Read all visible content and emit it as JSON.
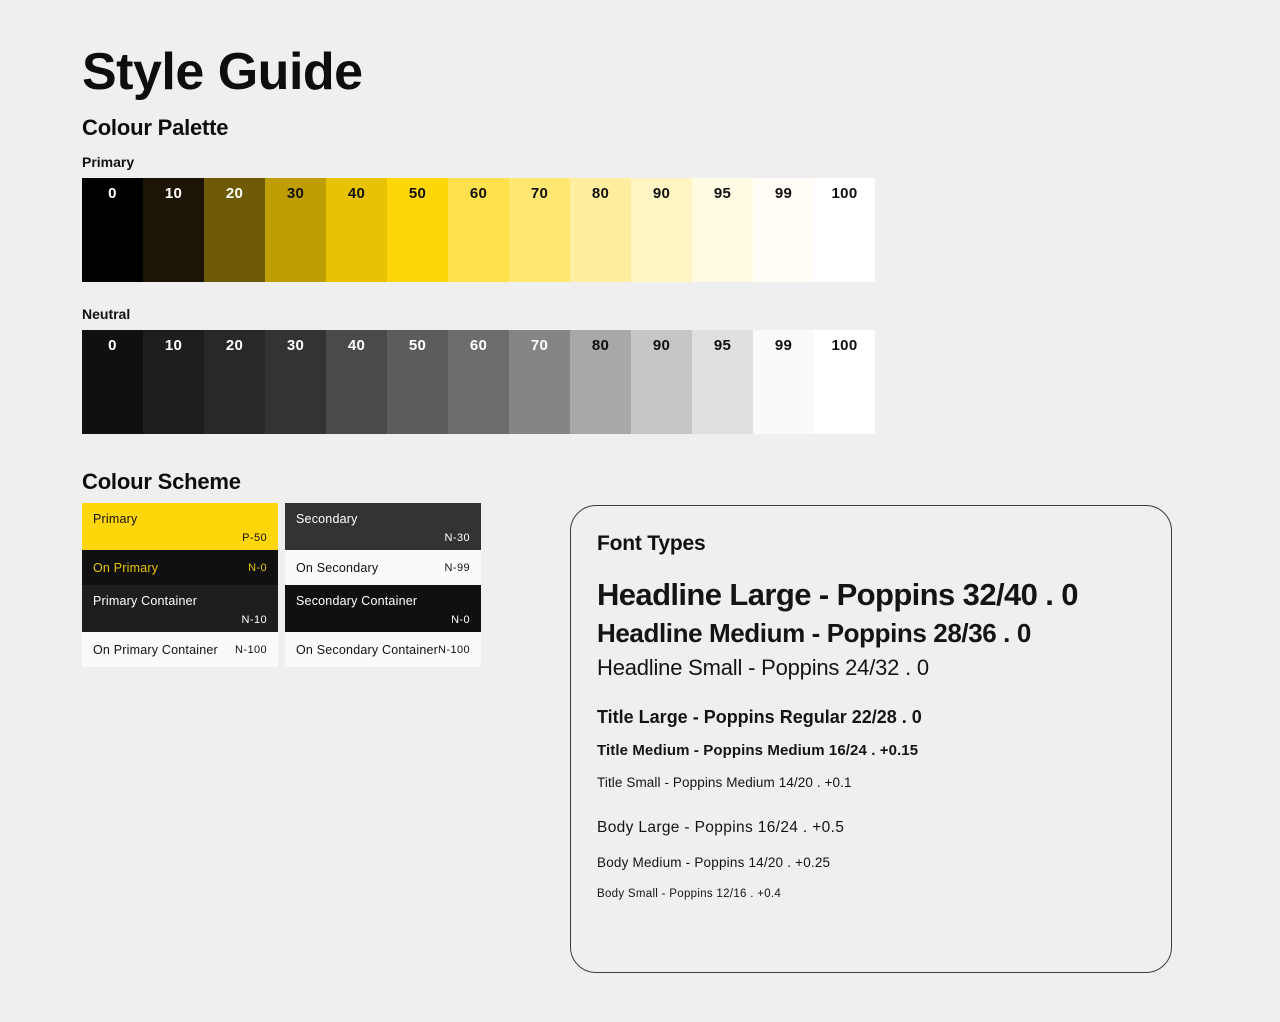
{
  "page": {
    "title": "Style Guide",
    "background": "#efefef"
  },
  "palette_section": {
    "title": "Colour Palette",
    "primary": {
      "label": "Primary",
      "tones": [
        {
          "label": "0",
          "hex": "#000000",
          "text": "#ffffff"
        },
        {
          "label": "10",
          "hex": "#1c1503",
          "text": "#ffffff"
        },
        {
          "label": "20",
          "hex": "#6e5a04",
          "text": "#ffffff"
        },
        {
          "label": "30",
          "hex": "#bf9e05",
          "text": "#111111"
        },
        {
          "label": "40",
          "hex": "#e8c303",
          "text": "#111111"
        },
        {
          "label": "50",
          "hex": "#ffd60a",
          "text": "#111111"
        },
        {
          "label": "60",
          "hex": "#ffe04d",
          "text": "#111111"
        },
        {
          "label": "70",
          "hex": "#ffe772",
          "text": "#111111"
        },
        {
          "label": "80",
          "hex": "#ffeea0",
          "text": "#111111"
        },
        {
          "label": "90",
          "hex": "#fff4c4",
          "text": "#111111"
        },
        {
          "label": "95",
          "hex": "#fffae2",
          "text": "#111111"
        },
        {
          "label": "99",
          "hex": "#fffdf5",
          "text": "#111111"
        },
        {
          "label": "100",
          "hex": "#ffffff",
          "text": "#111111"
        }
      ]
    },
    "neutral": {
      "label": "Neutral",
      "tones": [
        {
          "label": "0",
          "hex": "#101010",
          "text": "#ffffff"
        },
        {
          "label": "10",
          "hex": "#1e1e1e",
          "text": "#ffffff"
        },
        {
          "label": "20",
          "hex": "#282828",
          "text": "#ffffff"
        },
        {
          "label": "30",
          "hex": "#333333",
          "text": "#ffffff"
        },
        {
          "label": "40",
          "hex": "#4a4a4a",
          "text": "#ffffff"
        },
        {
          "label": "50",
          "hex": "#5c5c5c",
          "text": "#ffffff"
        },
        {
          "label": "60",
          "hex": "#6c6c6c",
          "text": "#ffffff"
        },
        {
          "label": "70",
          "hex": "#858585",
          "text": "#ffffff"
        },
        {
          "label": "80",
          "hex": "#a8a8a8",
          "text": "#111111"
        },
        {
          "label": "90",
          "hex": "#c6c6c6",
          "text": "#111111"
        },
        {
          "label": "95",
          "hex": "#e0e0e0",
          "text": "#111111"
        },
        {
          "label": "99",
          "hex": "#fafafa",
          "text": "#111111"
        },
        {
          "label": "100",
          "hex": "#ffffff",
          "text": "#111111"
        }
      ]
    }
  },
  "scheme_section": {
    "title": "Colour Scheme",
    "primary_card": [
      {
        "name": "Primary",
        "token": "P-50",
        "bg": "#ffd60a",
        "fg": "#111111",
        "layout": "tall"
      },
      {
        "name": "On Primary",
        "token": "N-0",
        "bg": "#101010",
        "fg": "#e8c30a",
        "layout": "compact"
      },
      {
        "name": "Primary Container",
        "token": "N-10",
        "bg": "#1e1e1e",
        "fg": "#ffffff",
        "layout": "tall"
      },
      {
        "name": "On Primary Container",
        "token": "N-100",
        "bg": "#fafafa",
        "fg": "#111111",
        "layout": "compact"
      }
    ],
    "secondary_card": [
      {
        "name": "Secondary",
        "token": "N-30",
        "bg": "#333333",
        "fg": "#ffffff",
        "layout": "tall"
      },
      {
        "name": "On Secondary",
        "token": "N-99",
        "bg": "#fafafa",
        "fg": "#111111",
        "layout": "compact"
      },
      {
        "name": "Secondary Container",
        "token": "N-0",
        "bg": "#101010",
        "fg": "#ffffff",
        "layout": "tall"
      },
      {
        "name": "On Secondary Container",
        "token": "N-100",
        "bg": "#fafafa",
        "fg": "#111111",
        "layout": "compact"
      }
    ]
  },
  "font_card": {
    "title": "Font Types",
    "specimens": [
      {
        "text": "Headline Large - Poppins 32/40 . 0",
        "style": "fs-hl-large"
      },
      {
        "text": "Headline Medium - Poppins 28/36 . 0",
        "style": "fs-hl-medium"
      },
      {
        "text": "Headline Small - Poppins 24/32 . 0",
        "style": "fs-hl-small"
      },
      {
        "text": "Title Large - Poppins Regular 22/28 . 0",
        "style": "fs-ti-large"
      },
      {
        "text": "Title Medium - Poppins Medium 16/24 . +0.15",
        "style": "fs-ti-medium"
      },
      {
        "text": "Title Small - Poppins Medium 14/20 . +0.1",
        "style": "fs-ti-small"
      },
      {
        "text": "Body Large - Poppins 16/24 . +0.5",
        "style": "fs-bd-large"
      },
      {
        "text": "Body Medium - Poppins 14/20 . +0.25",
        "style": "fs-bd-medium"
      },
      {
        "text": "Body Small - Poppins 12/16 . +0.4",
        "style": "fs-bd-small"
      }
    ]
  }
}
